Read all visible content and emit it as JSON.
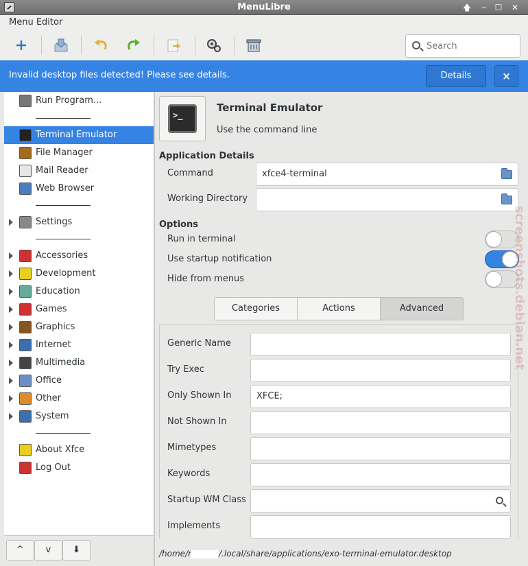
{
  "window": {
    "title": "MenuLibre",
    "controls": [
      "🡅",
      "‒",
      "☐",
      "✕"
    ]
  },
  "menubar": {
    "menu_label": "Menu Editor"
  },
  "search": {
    "placeholder": "Search"
  },
  "infobar": {
    "message": "Invalid desktop files detected! Please see details.",
    "details_label": "Details",
    "close_label": "×"
  },
  "tree": {
    "items": [
      {
        "label": "Run Program...",
        "icon": "gears-icon",
        "color": "#777"
      },
      {
        "label": "Terminal Emulator",
        "icon": "terminal-icon",
        "color": "#222",
        "selected": true
      },
      {
        "label": "File Manager",
        "icon": "file-cabinet-icon",
        "color": "#a56a1d"
      },
      {
        "label": "Mail Reader",
        "icon": "envelope-icon",
        "color": "#e6e6e6"
      },
      {
        "label": "Web Browser",
        "icon": "globe-icon",
        "color": "#4a7ec0"
      },
      {
        "label": "Settings",
        "icon": "settings-panel-icon",
        "color": "#888"
      },
      {
        "label": "Accessories",
        "icon": "scissors-icon",
        "color": "#c33"
      },
      {
        "label": "Development",
        "icon": "bulb-icon",
        "color": "#e8d020"
      },
      {
        "label": "Education",
        "icon": "flask-icon",
        "color": "#6a9"
      },
      {
        "label": "Games",
        "icon": "cards-icon",
        "color": "#c33"
      },
      {
        "label": "Graphics",
        "icon": "brush-icon",
        "color": "#885522"
      },
      {
        "label": "Internet",
        "icon": "internet-globe-icon",
        "color": "#3a6fb0"
      },
      {
        "label": "Multimedia",
        "icon": "film-icon",
        "color": "#444"
      },
      {
        "label": "Office",
        "icon": "office-icon",
        "color": "#6b8fc4"
      },
      {
        "label": "Other",
        "icon": "diamond-icon",
        "color": "#e08a2a"
      },
      {
        "label": "System",
        "icon": "gear-icon",
        "color": "#3a6fb0"
      },
      {
        "label": "About Xfce",
        "icon": "star-icon",
        "color": "#e8d020"
      },
      {
        "label": "Log Out",
        "icon": "logout-icon",
        "color": "#c33"
      }
    ],
    "bottom_buttons": [
      "^",
      "v",
      "⬇"
    ]
  },
  "app": {
    "name": "Terminal Emulator",
    "comment": "Use the command line",
    "icon_text": ">_"
  },
  "details": {
    "section_title": "Application Details",
    "command_label": "Command",
    "command_value": "xfce4-terminal",
    "workdir_label": "Working Directory",
    "workdir_value": ""
  },
  "options": {
    "section_title": "Options",
    "run_in_terminal_label": "Run in terminal",
    "run_in_terminal": false,
    "startup_notify_label": "Use startup notification",
    "startup_notify": true,
    "hide_label": "Hide from menus",
    "hide": false
  },
  "tabs": [
    {
      "label": "Categories",
      "active": false
    },
    {
      "label": "Actions",
      "active": false
    },
    {
      "label": "Advanced",
      "active": true
    }
  ],
  "advanced": {
    "fields": [
      {
        "label": "Generic Name",
        "value": ""
      },
      {
        "label": "Try Exec",
        "value": ""
      },
      {
        "label": "Only Shown In",
        "value": "XFCE;"
      },
      {
        "label": "Not Shown In",
        "value": ""
      },
      {
        "label": "Mimetypes",
        "value": ""
      },
      {
        "label": "Keywords",
        "value": ""
      },
      {
        "label": "Startup WM Class",
        "value": ""
      },
      {
        "label": "Implements",
        "value": ""
      }
    ]
  },
  "status": {
    "path_prefix": "/home/r",
    "path_suffix": "/.local/share/applications/exo-terminal-emulator.desktop"
  },
  "watermark": "screenshots.debian.net"
}
